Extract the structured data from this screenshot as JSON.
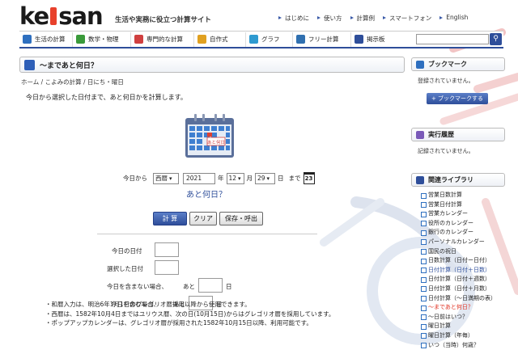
{
  "brand": {
    "logo_pre": "ke",
    "logo_post": "san",
    "tagline": "生活や実務に役立つ計算サイト"
  },
  "topnav": [
    "はじめに",
    "使い方",
    "計算例",
    "スマートフォン",
    "English"
  ],
  "mainnav": [
    {
      "label": "生活の計算",
      "icon": "life-calc-icon",
      "color": "#2e6fbf"
    },
    {
      "label": "数学・物理",
      "icon": "math-icon",
      "color": "#3a9a3a"
    },
    {
      "label": "専門的な計算",
      "icon": "book-icon",
      "color": "#d04040"
    },
    {
      "label": "自作式",
      "icon": "custom-formula-icon",
      "color": "#e0a020"
    },
    {
      "label": "グラフ",
      "icon": "graph-icon",
      "color": "#2e9ad0"
    },
    {
      "label": "フリー計算",
      "icon": "pencil-icon",
      "color": "#3070b0"
    },
    {
      "label": "掲示板",
      "icon": "board-icon",
      "color": "#2e4e9a"
    }
  ],
  "page": {
    "title": "〜まであと何日？",
    "breadcrumb": "ホーム / こよみの計算 / 日にち・曜日",
    "description": "今日から選択した日付まで、あと何日かを計算します。",
    "calendar_label": "あと何日"
  },
  "form": {
    "from_label": "今日から",
    "era": "西暦",
    "year": "2021",
    "year_unit": "年",
    "month": "12",
    "month_unit": "月",
    "day": "29",
    "day_unit": "日",
    "until_label": "まで",
    "cal_icon_day": "23",
    "question": "あと何日？"
  },
  "buttons": {
    "calc": "計 算",
    "clear": "クリア",
    "save": "保存・呼出"
  },
  "results": {
    "today_label": "今日の日付",
    "selected_label": "選択した日付",
    "excl_label": "今日を含まない場合、",
    "incl_label": "今日を含む場合、",
    "ato": "あと",
    "day_unit": "日"
  },
  "notes": [
    "・和暦入力は、明治6年1月1日のグレゴリオ暦採用以降から使用できます。",
    "・西暦は、1582年10月4日まではユリウス暦、次の日(10月15日)からはグレゴリオ暦を採用しています。",
    "・ポップアップカレンダーは、グレゴリオ暦が採用された1582年10月15日以降、利用可能です。"
  ],
  "sidebar": {
    "bookmark_title": "ブックマーク",
    "bookmark_text": "登録されていません。",
    "bookmark_button": "+ ブックマークする",
    "history_title": "実行履歴",
    "history_text": "記録されていません。",
    "library_title": "関連ライブラリ",
    "library": [
      "営業日数計算",
      "営業日付計算",
      "営業カレンダー",
      "役所のカレンダー",
      "銀行のカレンダー",
      "パーソナルカレンダー",
      "国民の祝日",
      "日数計算（日付ー日付）",
      "日付計算（日付＋日数）",
      "日付計算（日付＋週数）",
      "日付計算（日付＋月数）",
      "日付計算（〜日満期の表）",
      "〜まであと何日？",
      "〜日前はいつ？",
      "曜日計算",
      "曜日計算（年毎）",
      "いつ（当時）何歳？"
    ],
    "library_current": "〜まであと何日？"
  },
  "search": {
    "placeholder": ""
  }
}
